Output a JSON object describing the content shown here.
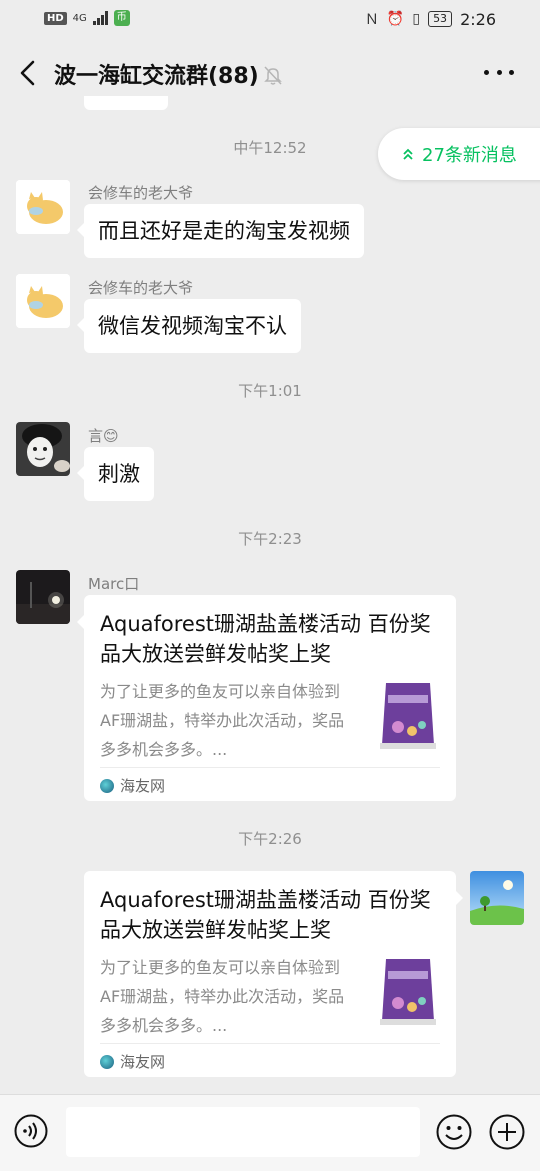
{
  "status_bar": {
    "network": "4G",
    "hd": "HD",
    "battery": "53",
    "time": "2:26",
    "app": "币"
  },
  "header": {
    "title": "波一海缸交流群(88)"
  },
  "new_messages": {
    "label": "27条新消息"
  },
  "timestamps": [
    "中午12:52",
    "下午1:01",
    "下午2:23",
    "下午2:26"
  ],
  "messages": [
    {
      "sender": "会修车的老大爷",
      "text": "而且还好是走的淘宝发视频"
    },
    {
      "sender": "会修车的老大爷",
      "text": "微信发视频淘宝不认"
    },
    {
      "sender": "言😊",
      "text": "刺激"
    },
    {
      "sender": "Marc口",
      "card": {
        "title": "Aquaforest珊湖盐盖楼活动 百份奖品大放送尝鲜发帖奖上奖",
        "description": "为了让更多的鱼友可以亲自体验到AF珊湖盐，特举办此次活动，奖品多多机会多多。...",
        "source": "海友网"
      }
    },
    {
      "sender": "",
      "card": {
        "title": "Aquaforest珊湖盐盖楼活动 百份奖品大放送尝鲜发帖奖上奖",
        "description": "为了让更多的鱼友可以亲自体验到AF珊湖盐，特举办此次活动，奖品多多机会多多。...",
        "source": "海友网"
      }
    }
  ],
  "input": {
    "placeholder": ""
  },
  "colors": {
    "accent": "#07c160",
    "background": "#ededed",
    "bubble": "#ffffff"
  }
}
